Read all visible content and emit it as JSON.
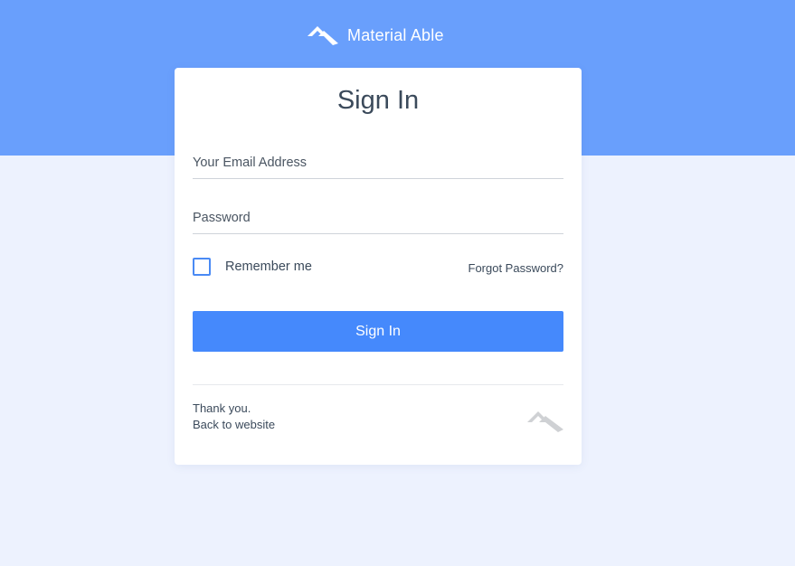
{
  "brand": {
    "name": "Material Able",
    "logo_icon": "mountain-logo-icon"
  },
  "form": {
    "title": "Sign In",
    "email_placeholder": "Your Email Address",
    "password_placeholder": "Password",
    "remember_label": "Remember me",
    "remember_checked": false,
    "forgot_label": "Forgot Password?",
    "submit_label": "Sign In"
  },
  "footer": {
    "thanks": "Thank you.",
    "back_link": "Back to website",
    "logo_icon": "mountain-logo-icon"
  },
  "colors": {
    "banner": "#699ffc",
    "background": "#edf2fe",
    "primary_button": "#4589fc",
    "checkbox_border": "#4a8af4",
    "text": "#3b4a5b"
  }
}
